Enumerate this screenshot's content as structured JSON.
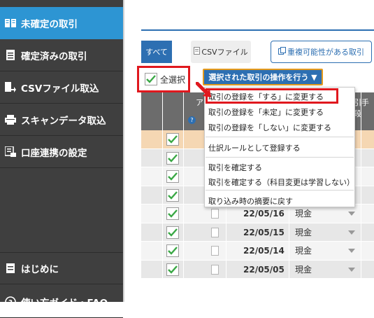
{
  "sidebar": {
    "items": [
      {
        "label": "未確定の取引",
        "icon": "book-icon"
      },
      {
        "label": "確定済みの取引",
        "icon": "document-icon"
      },
      {
        "label": "CSVファイル取込",
        "icon": "file-import-icon"
      },
      {
        "label": "スキャンデータ取込",
        "icon": "scanner-icon"
      },
      {
        "label": "口座連携の設定",
        "icon": "bank-account-icon"
      },
      {
        "label": "はじめに",
        "icon": "document-icon"
      },
      {
        "label": "使い方ガイド・FAQ",
        "icon": "help-icon"
      }
    ]
  },
  "tabs": {
    "all": "すべて",
    "csv": "CSVファイル",
    "duplicate": "重複可能性がある取引"
  },
  "select_all_label": "全選択",
  "operation_button_label": "選択された取引の操作を行う ▼",
  "menu": {
    "items": [
      "取引の登録を「する」に変更する",
      "取引の登録を「未定」に変更する",
      "取引の登録を「しない」に変更する",
      "仕訳ルールとして登録する",
      "取引を確定する",
      "取引を確定する（科目変更は学習しない）",
      "取り込み時の摘要に戻す"
    ]
  },
  "table": {
    "header_partial_left": "ア",
    "header_partial_right": "引手段",
    "help_badge": "?",
    "rows": [
      {
        "date": "",
        "account": ""
      },
      {
        "date": "",
        "account": ""
      },
      {
        "date": "",
        "account": ""
      },
      {
        "date": "",
        "account": ""
      },
      {
        "date": "22/05/16",
        "account": "現金"
      },
      {
        "date": "22/05/15",
        "account": "現金"
      },
      {
        "date": "22/05/14",
        "account": "現金"
      },
      {
        "date": "22/05/05",
        "account": "現金"
      }
    ]
  },
  "colors": {
    "sidebar_bg": "#3f3f3f",
    "active_item": "#2d95d3",
    "primary_blue": "#2d6fb2",
    "highlight_red": "#e0181e",
    "check_green": "#3aa845"
  }
}
